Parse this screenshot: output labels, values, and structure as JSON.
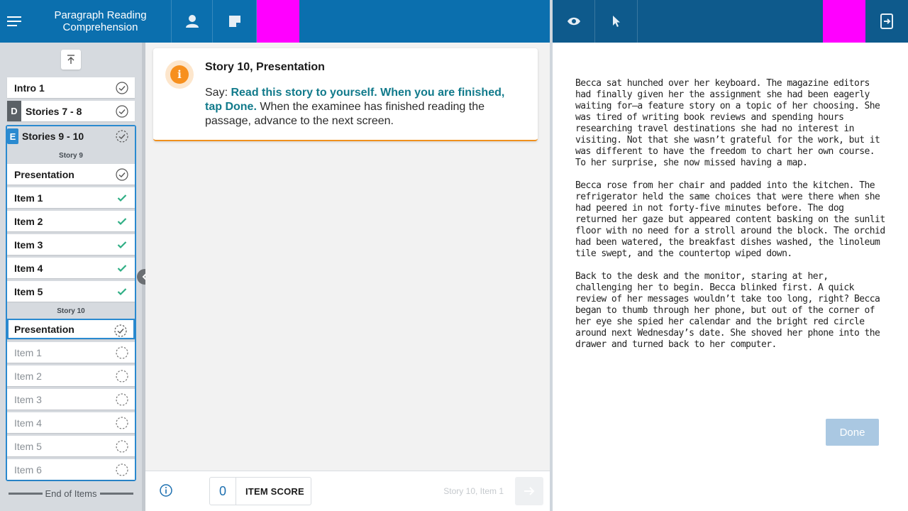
{
  "header": {
    "app_title": "Paragraph Reading Comprehension",
    "icons": [
      "menu-icon",
      "user-icon",
      "note-icon",
      "eye-icon",
      "pointer-icon",
      "exit-tablet-icon"
    ],
    "accent_color": "#0b6fae",
    "right_bar_color": "#0e5a8c",
    "highlight_color": "#ff00ff"
  },
  "sidebar": {
    "intro": {
      "label": "Intro 1",
      "status": "complete"
    },
    "stories_7_8": {
      "badge": "D",
      "label": "Stories 7 - 8",
      "status": "complete"
    },
    "stories_9_10": {
      "badge": "E",
      "label": "Stories 9 - 10",
      "status": "in-progress",
      "story9": {
        "heading": "Story 9",
        "items": [
          {
            "label": "Presentation",
            "status": "complete"
          },
          {
            "label": "Item 1",
            "status": "answered"
          },
          {
            "label": "Item 2",
            "status": "answered"
          },
          {
            "label": "Item 3",
            "status": "answered"
          },
          {
            "label": "Item 4",
            "status": "answered"
          },
          {
            "label": "Item 5",
            "status": "answered"
          }
        ]
      },
      "story10": {
        "heading": "Story 10",
        "items": [
          {
            "label": "Presentation",
            "status": "in-progress"
          },
          {
            "label": "Item 1",
            "status": "not-started"
          },
          {
            "label": "Item 2",
            "status": "not-started"
          },
          {
            "label": "Item 3",
            "status": "not-started"
          },
          {
            "label": "Item 4",
            "status": "not-started"
          },
          {
            "label": "Item 5",
            "status": "not-started"
          },
          {
            "label": "Item 6",
            "status": "not-started"
          }
        ]
      }
    },
    "end_label": "End of Items"
  },
  "card": {
    "title": "Story 10, Presentation",
    "say_prefix": "Say: ",
    "say_text": "Read this story to yourself. When you are finished, tap Done.",
    "instruction": " When the examinee has finished reading the passage, advance to the next screen."
  },
  "footer": {
    "item_score_value": "0",
    "item_score_label": "ITEM SCORE",
    "position_label": "Story 10, Item 1"
  },
  "story": {
    "paragraphs": [
      "Becca sat hunched over her keyboard. The magazine editors had finally given her the assignment she had been eagerly waiting for—a feature story on a topic of her choosing. She was tired of writing book reviews and spending hours researching travel destinations she had no interest in visiting. Not that she wasn’t grateful for the work, but it was different to have the freedom to chart her own course. To her surprise, she now missed having a map.",
      "Becca rose from her chair and padded into the kitchen. The refrigerator held the same choices that were there when she had peered in not forty-five minutes before. The dog returned her gaze but appeared content basking on the sunlit floor with no need for a stroll around the block. The orchid had been watered, the breakfast dishes washed, the linoleum tile swept, and the countertop wiped down.",
      "Back to the desk and the monitor, staring at her, challenging her to begin. Becca blinked first. A quick review of her messages wouldn’t take too long, right? Becca began to thumb through her phone, but out of the corner of her eye she spied her calendar and the bright red circle around next Wednesday’s date. She shoved her phone into the drawer and turned back to her computer."
    ],
    "done_label": "Done"
  }
}
